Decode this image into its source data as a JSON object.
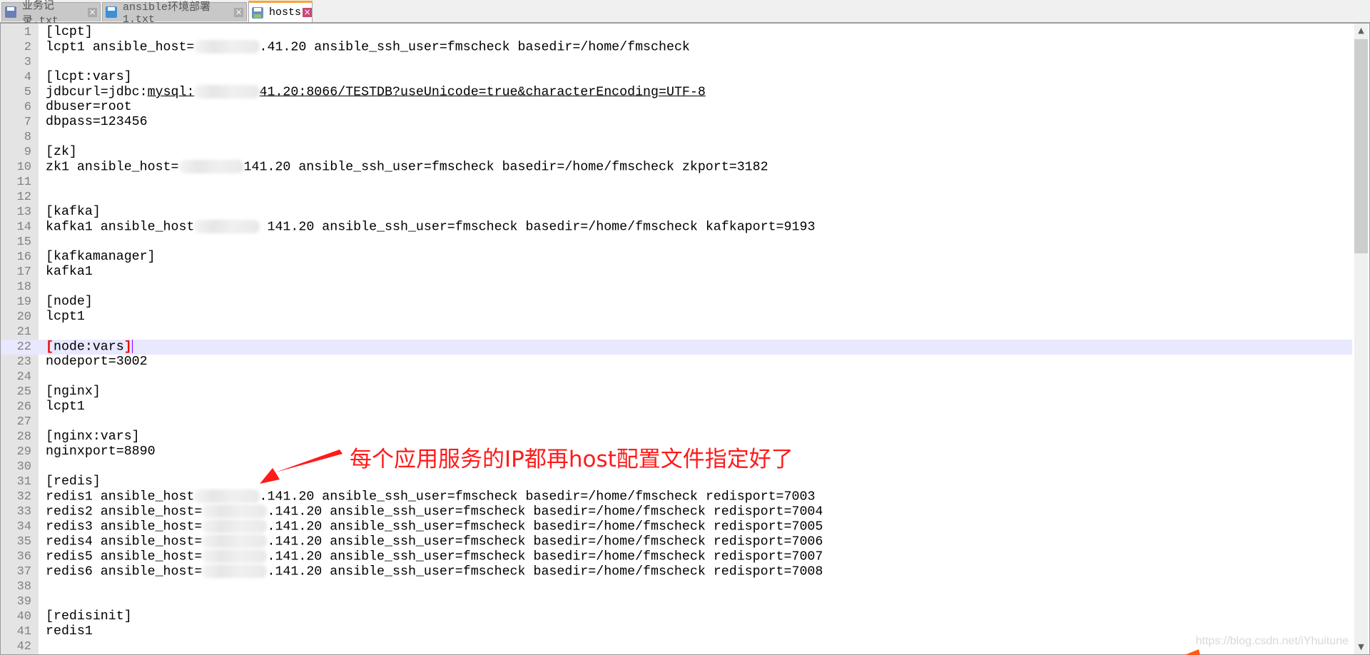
{
  "tabs": [
    {
      "label": "业务记录.txt",
      "active": false
    },
    {
      "label": "ansible环境部署1.txt",
      "active": false
    },
    {
      "label": "hosts",
      "active": true
    }
  ],
  "current_line": 22,
  "lines": [
    {
      "n": "1",
      "pre": "[lcpt]"
    },
    {
      "n": "2",
      "pre": "lcpt1 ansible_host=",
      "mask": true,
      "post": ".41.20 ansible_ssh_user=fmscheck basedir=/home/fmscheck"
    },
    {
      "n": "3",
      "pre": ""
    },
    {
      "n": "4",
      "pre": "[lcpt:vars]"
    },
    {
      "n": "5",
      "pre": "jdbcurl=jdbc:",
      "link_pre": "mysql:",
      "mask": true,
      "link_post": "41.20:8066/TESTDB?useUnicode=true&characterEncoding=UTF-8"
    },
    {
      "n": "6",
      "pre": "dbuser=root"
    },
    {
      "n": "7",
      "pre": "dbpass=123456"
    },
    {
      "n": "8",
      "pre": ""
    },
    {
      "n": "9",
      "pre": "[zk]"
    },
    {
      "n": "10",
      "pre": "zk1 ansible_host=",
      "mask": true,
      "post": "141.20 ansible_ssh_user=fmscheck basedir=/home/fmscheck zkport=3182"
    },
    {
      "n": "11",
      "pre": ""
    },
    {
      "n": "12",
      "pre": ""
    },
    {
      "n": "13",
      "pre": "[kafka]"
    },
    {
      "n": "14",
      "pre": "kafka1 ansible_host",
      "mask": true,
      "post": " 141.20 ansible_ssh_user=fmscheck basedir=/home/fmscheck kafkaport=9193"
    },
    {
      "n": "15",
      "pre": ""
    },
    {
      "n": "16",
      "pre": "[kafkamanager]"
    },
    {
      "n": "17",
      "pre": "kafka1"
    },
    {
      "n": "18",
      "pre": ""
    },
    {
      "n": "19",
      "pre": "[node]"
    },
    {
      "n": "20",
      "pre": "lcpt1"
    },
    {
      "n": "21",
      "pre": ""
    },
    {
      "n": "22",
      "pre": "node:vars",
      "bracket": true
    },
    {
      "n": "23",
      "pre": "nodeport=3002"
    },
    {
      "n": "24",
      "pre": ""
    },
    {
      "n": "25",
      "pre": "[nginx]"
    },
    {
      "n": "26",
      "pre": "lcpt1"
    },
    {
      "n": "27",
      "pre": ""
    },
    {
      "n": "28",
      "pre": "[nginx:vars]"
    },
    {
      "n": "29",
      "pre": "nginxport=8890"
    },
    {
      "n": "30",
      "pre": ""
    },
    {
      "n": "31",
      "pre": "[redis]"
    },
    {
      "n": "32",
      "pre": "redis1 ansible_host",
      "mask": true,
      "post": ".141.20 ansible_ssh_user=fmscheck basedir=/home/fmscheck redisport=7003"
    },
    {
      "n": "33",
      "pre": "redis2 ansible_host=",
      "mask": true,
      "post": ".141.20 ansible_ssh_user=fmscheck basedir=/home/fmscheck redisport=7004"
    },
    {
      "n": "34",
      "pre": "redis3 ansible_host=",
      "mask": true,
      "post": ".141.20 ansible_ssh_user=fmscheck basedir=/home/fmscheck redisport=7005"
    },
    {
      "n": "35",
      "pre": "redis4 ansible_host=",
      "mask": true,
      "post": ".141.20 ansible_ssh_user=fmscheck basedir=/home/fmscheck redisport=7006"
    },
    {
      "n": "36",
      "pre": "redis5 ansible_host=",
      "mask": true,
      "post": ".141.20 ansible_ssh_user=fmscheck basedir=/home/fmscheck redisport=7007"
    },
    {
      "n": "37",
      "pre": "redis6 ansible_host=",
      "mask": true,
      "post": ".141.20 ansible_ssh_user=fmscheck basedir=/home/fmscheck redisport=7008"
    },
    {
      "n": "38",
      "pre": ""
    },
    {
      "n": "39",
      "pre": ""
    },
    {
      "n": "40",
      "pre": "[redisinit]"
    },
    {
      "n": "41",
      "pre": "redis1"
    },
    {
      "n": "42",
      "pre": ""
    }
  ],
  "annotation": {
    "text": "每个应用服务的IP都再host配置文件指定好了",
    "color": "#ff1a1a"
  },
  "watermark": "https://blog.csdn.net/iYhuitune",
  "colors": {
    "active_tab_accent": "#f7a537",
    "current_line": "#e8e8ff",
    "brace_match": "#ee0000"
  }
}
